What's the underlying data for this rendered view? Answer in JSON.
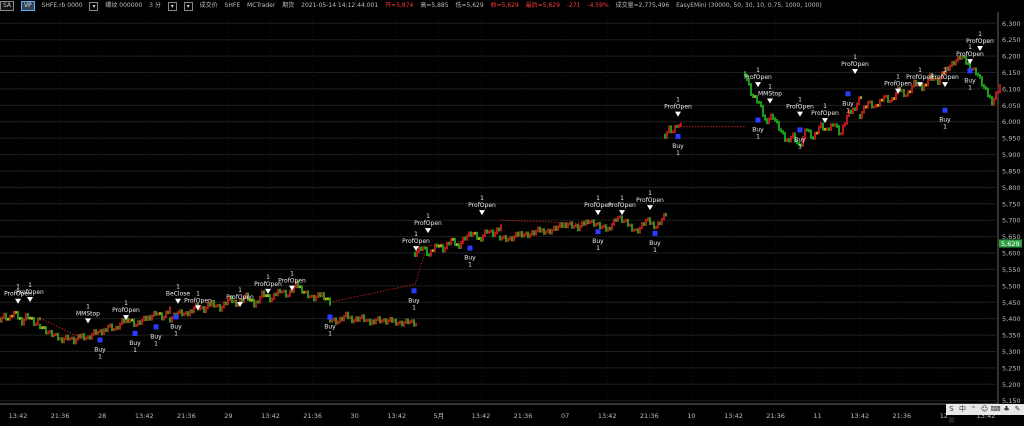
{
  "header": {
    "symbol_button": "SA",
    "vp_button": "VP",
    "symbol": "SHFE.rb 0000",
    "name": "螺纹 000000",
    "interval": "3 分",
    "last_price_label": "成交价",
    "exchange": "SHFE",
    "platform": "MCTrader",
    "mode_label": "期货",
    "datetime": "2021-05-14  14:12:44.001",
    "open": "开=5,874",
    "high": "高=5,885",
    "low": "低=5,629",
    "close": "收=5,629",
    "last": "最后=5,629",
    "change": "-271",
    "change_pct": "-4.59%",
    "volume": "成交量=2,775,496",
    "strategy": "EasyEMini (30000,  50,  30,  10,  0.75,  1000,  1000)"
  },
  "colors": {
    "up": "#e02020",
    "down": "#20c020",
    "flat": "#e0d020",
    "buy_marker": "#2a3cff",
    "price_badge": "#2ea043",
    "link": "#e02020"
  },
  "chart_data": {
    "type": "line",
    "y_ticks": [
      "6,300",
      "6,250",
      "6,200",
      "6,150",
      "6,100",
      "6,050",
      "6,000",
      "5,950",
      "5,900",
      "5,850",
      "5,800",
      "5,750",
      "5,700",
      "5,650",
      "5,600",
      "5,550",
      "5,500",
      "5,450",
      "5,400",
      "5,350",
      "5,300",
      "5,250",
      "5,200",
      "5,150"
    ],
    "ylim": [
      5140,
      6310
    ],
    "x_ticks": [
      "13:42",
      "21:36",
      "28",
      "13:42",
      "21:36",
      "29",
      "13:42",
      "21:36",
      "30",
      "13:42",
      "5月",
      "13:42",
      "21:36",
      "07",
      "13:42",
      "21:36",
      "10",
      "13:42",
      "21:36",
      "11",
      "13:42",
      "21:36",
      "12",
      "13:42"
    ],
    "current_price": "5,629",
    "segments": [
      {
        "x": [
          0,
          40
        ],
        "y": [
          5400,
          5410,
          5395,
          5420,
          5405,
          5390,
          5412,
          5398,
          5380,
          5402
        ]
      },
      {
        "x": [
          40,
          170
        ],
        "y": [
          5380,
          5360,
          5350,
          5335,
          5345,
          5330,
          5350,
          5340,
          5360,
          5355,
          5380,
          5365,
          5390,
          5400,
          5380,
          5395,
          5405,
          5420,
          5400,
          5430
        ]
      },
      {
        "x": [
          170,
          330
        ],
        "y": [
          5400,
          5420,
          5410,
          5440,
          5425,
          5450,
          5430,
          5460,
          5445,
          5470,
          5440,
          5480,
          5455,
          5490,
          5470,
          5505,
          5480,
          5460,
          5475,
          5450
        ]
      },
      {
        "x": [
          330,
          415
        ],
        "y": [
          5400,
          5390,
          5410,
          5395,
          5405,
          5385,
          5400,
          5390,
          5395,
          5385,
          5392,
          5380
        ]
      },
      {
        "x": [
          415,
          500
        ],
        "y": [
          5600,
          5620,
          5590,
          5630,
          5610,
          5640,
          5620,
          5650,
          5660,
          5640,
          5670,
          5655,
          5680
        ]
      },
      {
        "x": [
          500,
          665
        ],
        "y": [
          5650,
          5640,
          5660,
          5655,
          5670,
          5665,
          5680,
          5690,
          5675,
          5700,
          5685,
          5670,
          5710,
          5690,
          5665,
          5700,
          5680,
          5720
        ]
      },
      {
        "x": [
          665,
          680
        ],
        "y": [
          5960,
          5980,
          5970,
          5990,
          5985
        ]
      },
      {
        "x": [
          745,
          860
        ],
        "y": [
          6150,
          6080,
          6060,
          6000,
          6020,
          5980,
          5940,
          5960,
          5920,
          5980,
          5950,
          5990,
          5970,
          6000,
          5960,
          6020,
          6040,
          6080
        ]
      },
      {
        "x": [
          860,
          1000
        ],
        "y": [
          6020,
          6060,
          6040,
          6080,
          6060,
          6100,
          6080,
          6120,
          6100,
          6140,
          6120,
          6160,
          6180,
          6200,
          6170,
          6150,
          6100,
          6060,
          6110
        ]
      }
    ],
    "links": [
      {
        "x": [
          40,
          85
        ],
        "y": [
          5402,
          5335
        ]
      },
      {
        "x": [
          330,
          415
        ],
        "y": [
          5450,
          5505
        ]
      },
      {
        "x": [
          415,
          425
        ],
        "y": [
          5505,
          5600
        ]
      },
      {
        "x": [
          425,
          470
        ],
        "y": [
          5620,
          5640
        ]
      },
      {
        "x": [
          500,
          590
        ],
        "y": [
          5700,
          5690
        ]
      },
      {
        "x": [
          680,
          745
        ],
        "y": [
          5985,
          5985
        ]
      }
    ],
    "annotations": [
      {
        "x": 18,
        "y": 5470,
        "text": "ProfOpen"
      },
      {
        "x": 30,
        "y": 5475,
        "text": "ProfOpen"
      },
      {
        "x": 88,
        "y": 5410,
        "text": "MMStop"
      },
      {
        "x": 100,
        "y": 5300,
        "text": "Buy"
      },
      {
        "x": 126,
        "y": 5420,
        "text": "ProfOpen"
      },
      {
        "x": 135,
        "y": 5320,
        "text": "Buy"
      },
      {
        "x": 156,
        "y": 5340,
        "text": "Buy"
      },
      {
        "x": 178,
        "y": 5470,
        "text": "BeClose"
      },
      {
        "x": 198,
        "y": 5450,
        "text": "ProfOpen"
      },
      {
        "x": 176,
        "y": 5370,
        "text": "Buy"
      },
      {
        "x": 240,
        "y": 5460,
        "text": "ProfOpen"
      },
      {
        "x": 268,
        "y": 5500,
        "text": "ProfOpen"
      },
      {
        "x": 292,
        "y": 5510,
        "text": "ProfOpen"
      },
      {
        "x": 330,
        "y": 5370,
        "text": "Buy"
      },
      {
        "x": 414,
        "y": 5450,
        "text": "Buy"
      },
      {
        "x": 416,
        "y": 5630,
        "text": "ProfOpen"
      },
      {
        "x": 428,
        "y": 5685,
        "text": "ProfOpen"
      },
      {
        "x": 470,
        "y": 5580,
        "text": "Buy"
      },
      {
        "x": 482,
        "y": 5740,
        "text": "ProfOpen"
      },
      {
        "x": 598,
        "y": 5740,
        "text": "ProfOpen"
      },
      {
        "x": 598,
        "y": 5630,
        "text": "Buy"
      },
      {
        "x": 622,
        "y": 5740,
        "text": "ProfOpen"
      },
      {
        "x": 655,
        "y": 5625,
        "text": "Buy"
      },
      {
        "x": 650,
        "y": 5755,
        "text": "ProfOpen"
      },
      {
        "x": 678,
        "y": 6040,
        "text": "ProfOpen"
      },
      {
        "x": 678,
        "y": 5920,
        "text": "Buy"
      },
      {
        "x": 758,
        "y": 6130,
        "text": "ProfOpen"
      },
      {
        "x": 758,
        "y": 5970,
        "text": "Buy"
      },
      {
        "x": 770,
        "y": 6080,
        "text": "MMStop"
      },
      {
        "x": 800,
        "y": 6040,
        "text": "ProfOpen"
      },
      {
        "x": 800,
        "y": 5940,
        "text": "Buy"
      },
      {
        "x": 825,
        "y": 6020,
        "text": "ProfOpen"
      },
      {
        "x": 855,
        "y": 6170,
        "text": "ProfOpen"
      },
      {
        "x": 848,
        "y": 6050,
        "text": "Buy"
      },
      {
        "x": 898,
        "y": 6110,
        "text": "ProfOpen"
      },
      {
        "x": 920,
        "y": 6130,
        "text": "ProfOpen"
      },
      {
        "x": 945,
        "y": 6130,
        "text": "ProfOpen"
      },
      {
        "x": 945,
        "y": 6000,
        "text": "Buy"
      },
      {
        "x": 970,
        "y": 6200,
        "text": "ProfOpen"
      },
      {
        "x": 980,
        "y": 6240,
        "text": "ProfOpen"
      },
      {
        "x": 970,
        "y": 6120,
        "text": "Buy"
      }
    ]
  },
  "corner_icons": [
    "S",
    "中",
    "⌃",
    "☺",
    "⌨",
    "♣",
    "✎",
    "▦"
  ]
}
